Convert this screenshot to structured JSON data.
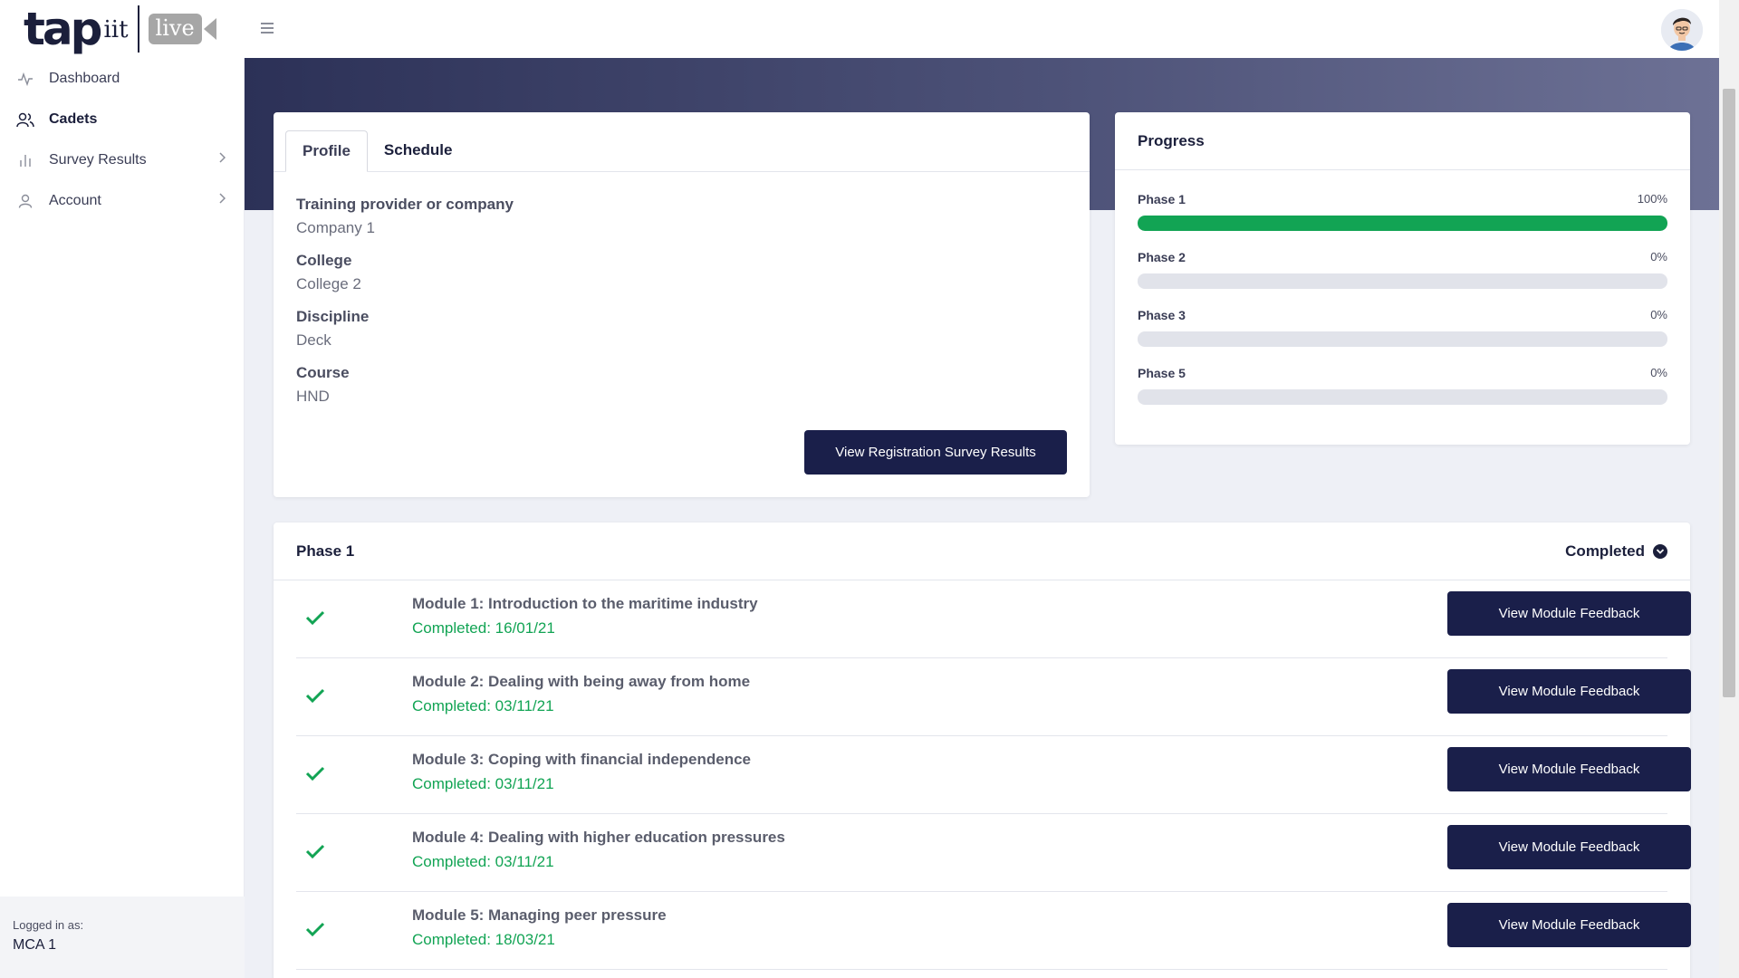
{
  "header": {
    "logo": {
      "word": "tap",
      "suffix": "iit",
      "badge": "live"
    }
  },
  "sidebar": {
    "items": [
      {
        "label": "Dashboard",
        "icon": "activity-icon",
        "active": false,
        "has_chevron": false
      },
      {
        "label": "Cadets",
        "icon": "users-icon",
        "active": true,
        "has_chevron": false
      },
      {
        "label": "Survey Results",
        "icon": "bar-chart-icon",
        "active": false,
        "has_chevron": true
      },
      {
        "label": "Account",
        "icon": "user-icon",
        "active": false,
        "has_chevron": true
      }
    ],
    "logged_in_label": "Logged in as:",
    "logged_in_user": "MCA 1"
  },
  "profile": {
    "tabs": [
      {
        "label": "Profile",
        "active": true
      },
      {
        "label": "Schedule",
        "active": false
      }
    ],
    "fields": [
      {
        "label": "Training provider or company",
        "value": "Company 1"
      },
      {
        "label": "College",
        "value": "College 2"
      },
      {
        "label": "Discipline",
        "value": "Deck"
      },
      {
        "label": "Course",
        "value": "HND"
      }
    ],
    "button": "View Registration Survey Results"
  },
  "progress": {
    "title": "Progress",
    "phases": [
      {
        "name": "Phase 1",
        "percent_label": "100%",
        "fraction": 1.0
      },
      {
        "name": "Phase 2",
        "percent_label": "0%",
        "fraction": 0
      },
      {
        "name": "Phase 3",
        "percent_label": "0%",
        "fraction": 0
      },
      {
        "name": "Phase 5",
        "percent_label": "0%",
        "fraction": 0
      }
    ]
  },
  "phase_section": {
    "title": "Phase 1",
    "status": "Completed",
    "modules": [
      {
        "title": "Module 1: Introduction to the maritime industry",
        "completed": "Completed: 16/01/21",
        "button": "View Module Feedback"
      },
      {
        "title": "Module 2: Dealing with being away from home",
        "completed": "Completed: 03/11/21",
        "button": "View Module Feedback"
      },
      {
        "title": "Module 3: Coping with financial independence",
        "completed": "Completed: 03/11/21",
        "button": "View Module Feedback"
      },
      {
        "title": "Module 4: Dealing with higher education pressures",
        "completed": "Completed: 03/11/21",
        "button": "View Module Feedback"
      },
      {
        "title": "Module 5: Managing peer pressure",
        "completed": "Completed: 18/03/21",
        "button": "View Module Feedback"
      }
    ]
  },
  "colors": {
    "navy": "#1a1f4a",
    "success_green": "#12a454",
    "track_grey": "#e1e3ea"
  }
}
